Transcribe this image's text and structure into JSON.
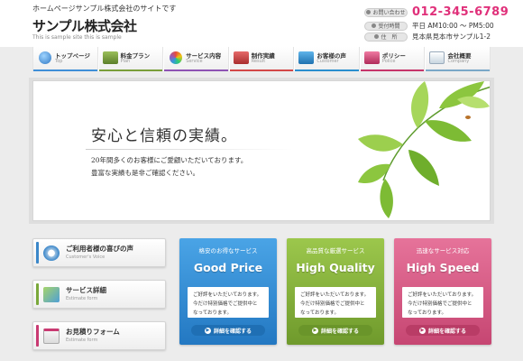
{
  "header": {
    "tagline": "ホームページサンプル株式会社のサイトです",
    "logo": "サンプル株式会社",
    "logo_sub": "This is sample site this is sample",
    "contact": [
      {
        "label": "お問い合わせ",
        "value": "012-345-6789",
        "icon": "phone-icon"
      },
      {
        "label": "受付時間",
        "value": "平日 AM10:00 ～ PM5:00",
        "icon": "clock-icon"
      },
      {
        "label": "住　所",
        "value": "見本県見本市サンプル1-2",
        "icon": "home-icon"
      }
    ]
  },
  "nav": [
    {
      "label": "トップページ",
      "sub": "Top",
      "icon": "globe-icon",
      "color": "#3f8fd8"
    },
    {
      "label": "料金プラン",
      "sub": "Plan",
      "icon": "money-icon",
      "color": "#7a9f3a"
    },
    {
      "label": "サービス内容",
      "sub": "Service",
      "icon": "color-wheel-icon",
      "color": "#8e53b4"
    },
    {
      "label": "制作実績",
      "sub": "Result",
      "icon": "toolbox-icon",
      "color": "#d34848"
    },
    {
      "label": "お客様の声",
      "sub": "Customer",
      "icon": "contact-card-icon",
      "color": "#2a8fcf"
    },
    {
      "label": "ポリシー",
      "sub": "Police",
      "icon": "policy-card-icon",
      "color": "#c7356a"
    },
    {
      "label": "会社概要",
      "sub": "Company",
      "icon": "document-icon",
      "color": "#7aa8c8"
    }
  ],
  "hero": {
    "title": "安心と信頼の実績。",
    "line1": "20年間多くのお客様にご愛顧いただいております。",
    "line2": "豊富な実績も是非ご確認ください。"
  },
  "side": [
    {
      "label": "ご利用者様の喜びの声",
      "sub": "Customer's Voice",
      "icon": "compass-icon",
      "accent": "#3b87c9"
    },
    {
      "label": "サービス詳細",
      "sub": "Estimate form",
      "icon": "map-icon",
      "accent": "#7aa83a"
    },
    {
      "label": "お見積りフォーム",
      "sub": "Estimate form",
      "icon": "notepad-icon",
      "accent": "#c93a72"
    }
  ],
  "cards": [
    {
      "top": "格安のお得なサービス",
      "title": "Good Price",
      "text1": "ご好評をいただいております。",
      "text2": "今だけ特別価格でご提供中と",
      "text3": "なっております。",
      "button": "詳細を確認する",
      "color": "#2e8ad1",
      "btn_color": "#1f6fb4"
    },
    {
      "top": "高品質な厳選サービス",
      "title": "High Quality",
      "text1": "ご好評をいただいております。",
      "text2": "今だけ特別価格でご提供中と",
      "text3": "なっております。",
      "button": "詳細を確認する",
      "color": "#86b23a",
      "btn_color": "#6a952a"
    },
    {
      "top": "迅速なサービス対応",
      "title": "High Speed",
      "text1": "ご好評をいただいております。",
      "text2": "今だけ特別価格でご提供中と",
      "text3": "なっております。",
      "button": "詳細を確認する",
      "color": "#d9547f",
      "btn_color": "#b93c66"
    }
  ]
}
